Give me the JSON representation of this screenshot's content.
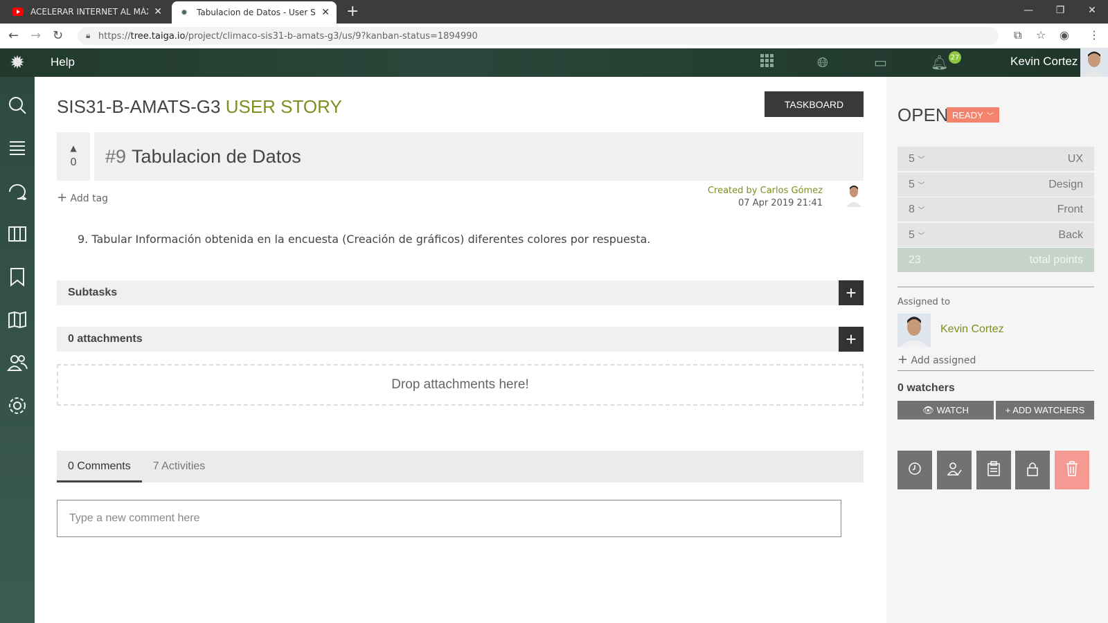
{
  "browser": {
    "tabs": [
      {
        "title": "ACELERAR INTERNET AL MÁXIMO",
        "active": false
      },
      {
        "title": "Tabulacion de Datos - User Story",
        "active": true
      }
    ],
    "url": {
      "scheme": "https://",
      "host": "tree.taiga.io",
      "path": "/project/climaco-sis31-b-amats-g3/us/9?kanban-status=1894990"
    }
  },
  "topnav": {
    "help": "Help",
    "notification_count": "27",
    "username": "Kevin Cortez"
  },
  "sidebar": {
    "items": [
      "search-icon",
      "backlog-icon",
      "timeline-icon",
      "kanban-icon",
      "epics-icon",
      "wiki-icon",
      "team-icon",
      "admin-icon"
    ]
  },
  "header": {
    "project": "SIS31-B-AMATS-G3",
    "kind": "USER STORY",
    "taskboard": "TASKBOARD"
  },
  "story": {
    "votes": "0",
    "ref": "#9",
    "title": "Tabulacion de Datos",
    "add_tag": "Add tag",
    "created_by_label": "Created by",
    "created_by": "Carlos Gómez",
    "created_date": "07 Apr 2019 21:41",
    "description": "9. Tabular Información obtenida en la encuesta (Creación de gráficos) diferentes colores por respuesta."
  },
  "sections": {
    "subtasks": "Subtasks",
    "attachments": "0 attachments",
    "drop": "Drop attachments here!"
  },
  "comments": {
    "tabs": [
      "0 Comments",
      "7 Activities"
    ],
    "placeholder": "Type a new comment here"
  },
  "right": {
    "status": "OPEN",
    "ready": "READY",
    "points": [
      {
        "value": "5",
        "role": "UX"
      },
      {
        "value": "5",
        "role": "Design"
      },
      {
        "value": "8",
        "role": "Front"
      },
      {
        "value": "5",
        "role": "Back"
      }
    ],
    "total": {
      "value": "23",
      "label": "total points"
    },
    "assigned_label": "Assigned to",
    "assignee": "Kevin Cortez",
    "add_assigned": "Add assigned",
    "watchers": "0 watchers",
    "watch": "WATCH",
    "add_watchers": "+ ADD WATCHERS"
  },
  "colors": {
    "accent": "#7d8f1f",
    "ready": "#f4836d",
    "nav": "#2b463a"
  }
}
